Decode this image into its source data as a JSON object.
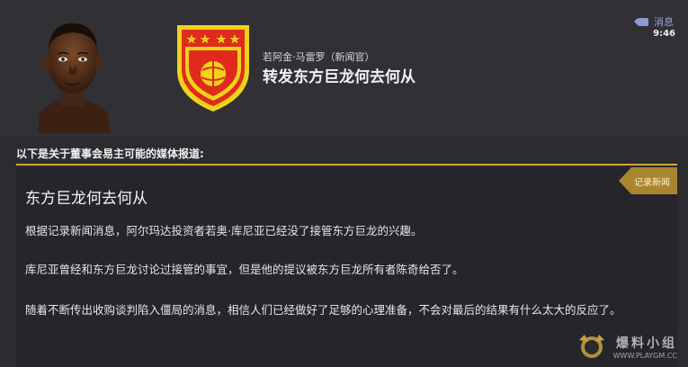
{
  "header": {
    "sender": "若阿金·马雷罗（新闻官）",
    "subject": "转发东方巨龙何去何从",
    "tag_label": "消息",
    "tag_icon": "label-icon",
    "time": "9:46"
  },
  "crest": {
    "icon": "club-crest-icon",
    "colors": {
      "shield": "#e02a1d",
      "border": "#f2d318",
      "stars": "#f2d318",
      "ball": "#f2d318"
    }
  },
  "intro": "以下是关于董事会易主可能的媒体报道:",
  "article": {
    "badge": "记录新闻",
    "title": "东方巨龙何去何从",
    "paragraphs": [
      "根据记录新闻消息，阿尔玛达投资者若奥·库尼亚已经没了接管东方巨龙的兴趣。",
      "库尼亚曾经和东方巨龙讨论过接管的事宜，但是他的提议被东方巨龙所有者陈奇给否了。",
      "随着不断传出收购谈判陷入僵局的消息，相信人们已经做好了足够的心理准备，不会对最后的结果有什么太大的反应了。"
    ]
  },
  "watermark": {
    "main": "爆料小组",
    "sub": "WWW.PLAYGM.CC"
  },
  "colors": {
    "accent_gold": "#d0a838",
    "badge_bg": "#a8852e",
    "tag_blue": "#8f9bd6"
  }
}
